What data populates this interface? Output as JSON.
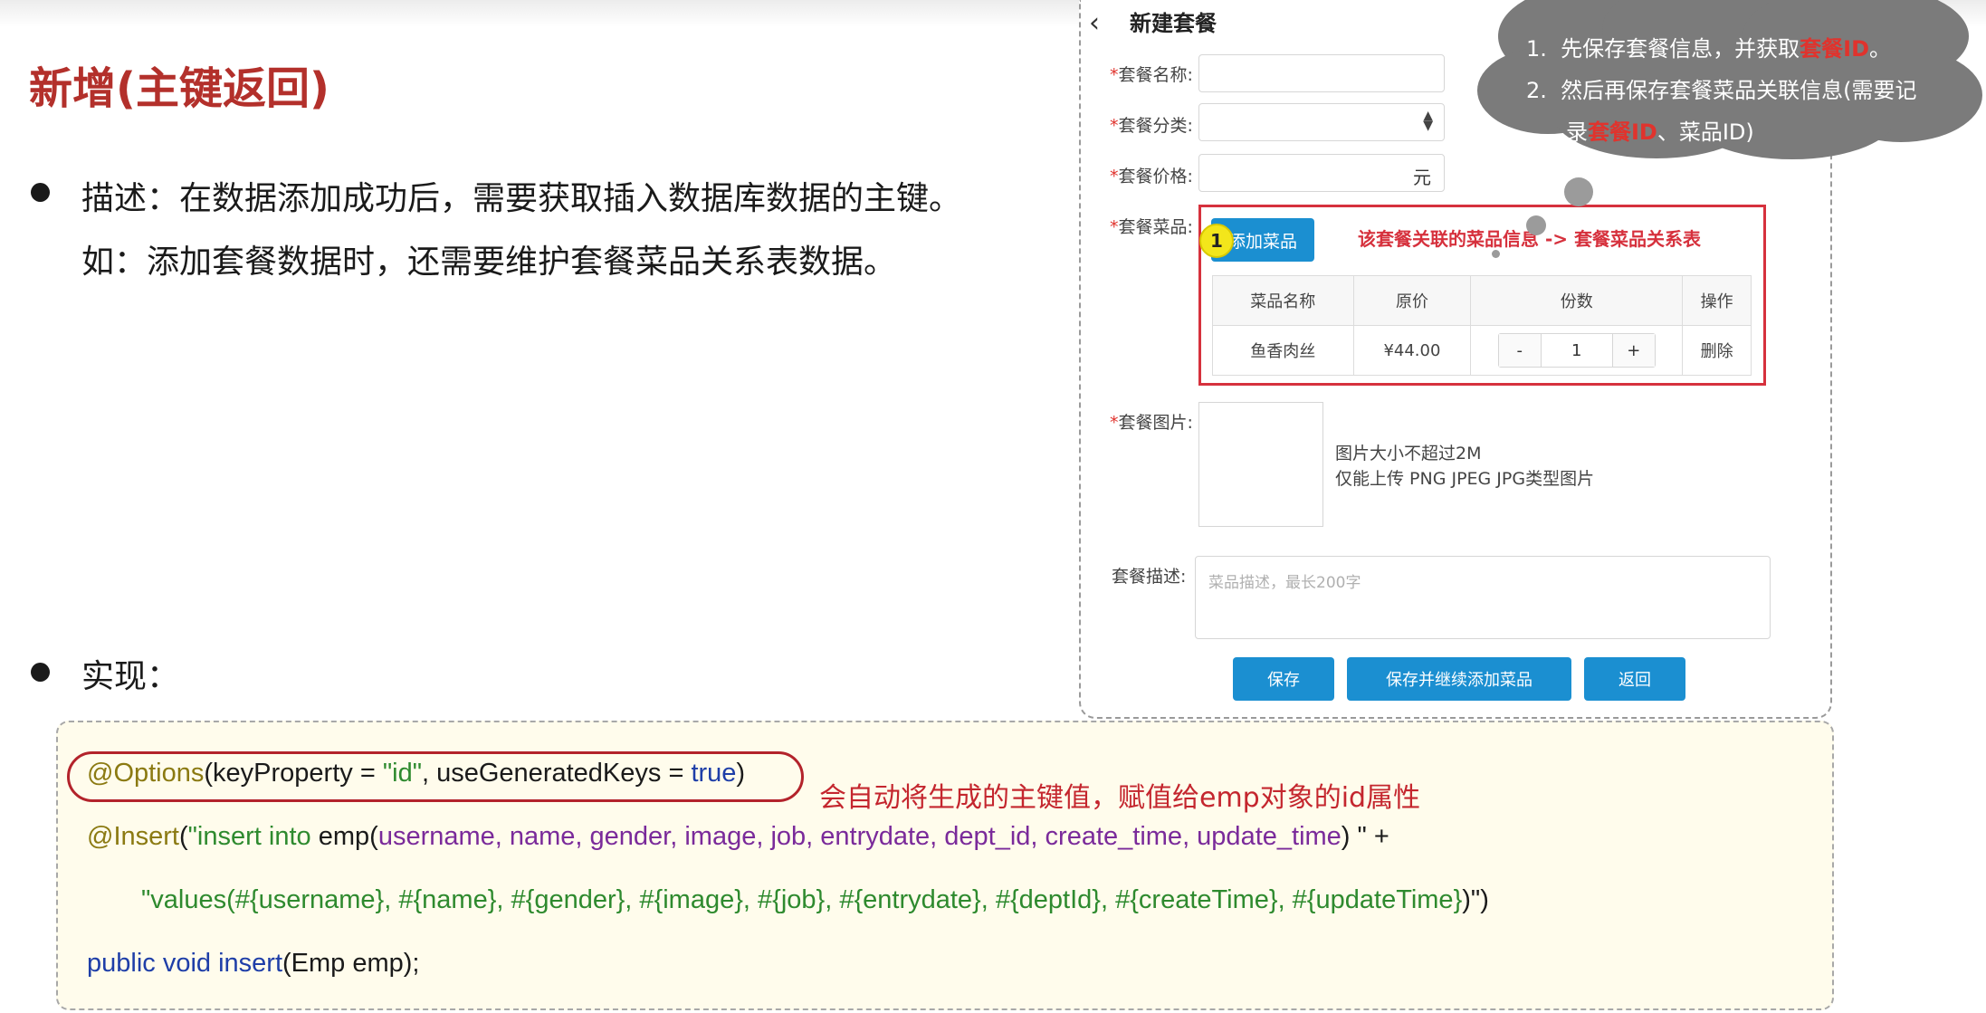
{
  "slide": {
    "title": "新增(主键返回)",
    "desc_line1": "描述：在数据添加成功后，需要获取插入数据库数据的主键。",
    "desc_line2": "如：添加套餐数据时，还需要维护套餐菜品关系表数据。",
    "impl_label": "实现："
  },
  "form": {
    "back_symbol": "‹",
    "title": "新建套餐",
    "required_mark": "*",
    "fields": {
      "name_label": "套餐名称:",
      "name_value": "",
      "category_label": "套餐分类:",
      "category_value": "",
      "price_label": "套餐价格:",
      "price_value": "",
      "price_unit": "元",
      "dishes_label": "套餐菜品:",
      "image_label": "套餐图片:",
      "desc_label": "套餐描述:",
      "desc_placeholder": "菜品描述，最长200字"
    },
    "add_dish_button": "添加菜品",
    "step_badge": "1",
    "relation_note": "该套餐关联的菜品信息 -> 套餐菜品关系表",
    "table": {
      "headers": [
        "菜品名称",
        "原价",
        "份数",
        "操作"
      ],
      "rows": [
        {
          "name": "鱼香肉丝",
          "price": "¥44.00",
          "minus": "-",
          "qty": "1",
          "plus": "+",
          "action": "删除"
        }
      ]
    },
    "upload_hint_1": "图片大小不超过2M",
    "upload_hint_2": "仅能上传 PNG JPEG JPG类型图片",
    "buttons": {
      "save": "保存",
      "save_continue": "保存并继续添加菜品",
      "back": "返回"
    }
  },
  "cloud": {
    "line1_num": "1.",
    "line1_text": "先保存套餐信息，并获取",
    "line1_hl": "套餐ID",
    "line1_end": "。",
    "line2_num": "2.",
    "line2_text": "然后再保存套餐菜品关联信息(需要记",
    "line3_pre": "录",
    "line3_hl": "套餐ID",
    "line3_end": "、菜品ID)"
  },
  "code": {
    "l1_anno": "@Options",
    "l1_a": "(keyProperty = ",
    "l1_str": "\"id\"",
    "l1_b": ", useGeneratedKeys = ",
    "l1_kw": "true",
    "l1_c": ")",
    "l2_anno": "@Insert",
    "l2_a": "(",
    "l2_str1": "\"insert into ",
    "l2_plain1": "emp(",
    "l2_vars": "username, name, gender, image, job, entrydate, dept_id, create_time, update_time",
    "l2_plain2": ") \" +",
    "l3_str1": "\"values(",
    "l3_vals": "#{username}, #{name}, #{gender}, #{image}, #{job}, #{entrydate}, #{deptId}, #{createTime}, #{updateTime}",
    "l3_end": ")\")",
    "l4_kw": "public void ",
    "l4_method": "insert",
    "l4_rest": "(Emp emp);",
    "note": "会自动将生成的主键值，赋值给emp对象的id属性"
  },
  "colors": {
    "title_red": "#b3302b",
    "accent_blue": "#1b8fd1",
    "highlight_red": "#d6313d",
    "code_bg": "#fffcec",
    "badge_yellow": "#f3e61b"
  }
}
